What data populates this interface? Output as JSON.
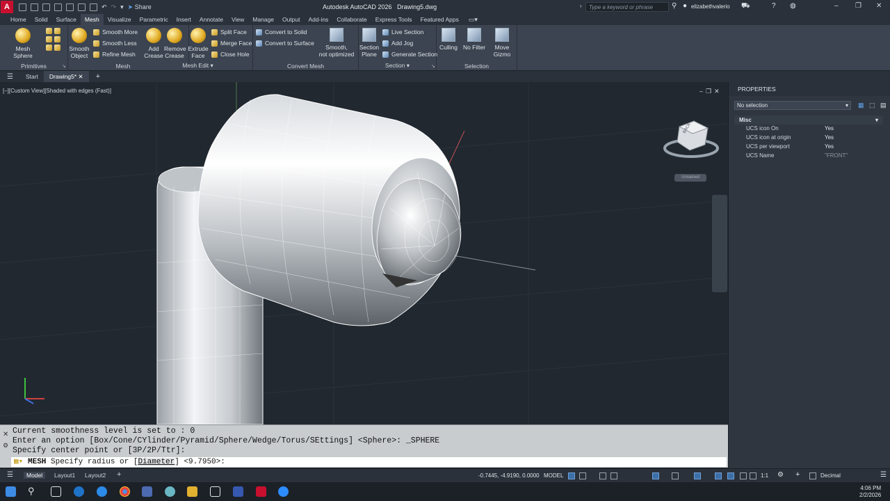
{
  "app": {
    "title": "Autodesk AutoCAD 2026",
    "file": "Drawing5.dwg",
    "logo": "A",
    "share": "Share",
    "search_placeholder": "Type a keyword or phrase",
    "user": "elizabethvalerio"
  },
  "ribbon_tabs": [
    "Home",
    "Solid",
    "Surface",
    "Mesh",
    "Visualize",
    "Parametric",
    "Insert",
    "Annotate",
    "View",
    "Manage",
    "Output",
    "Add-ins",
    "Collaborate",
    "Express Tools",
    "Featured Apps"
  ],
  "ribbon": {
    "primitives": {
      "title": "Primitives",
      "mesh_sphere": "Mesh Sphere"
    },
    "mesh": {
      "title": "Mesh",
      "smooth_object": [
        "Smooth",
        "Object"
      ],
      "smooth_more": "Smooth More",
      "smooth_less": "Smooth Less",
      "refine_mesh": "Refine Mesh"
    },
    "mesh_edit": {
      "title": "Mesh Edit",
      "add_crease": [
        "Add",
        "Crease"
      ],
      "remove_crease": [
        "Remove",
        "Crease"
      ],
      "extrude_face": [
        "Extrude",
        "Face"
      ],
      "split_face": "Split Face",
      "merge_face": "Merge Face",
      "close_hole": "Close Hole"
    },
    "convert_mesh": {
      "title": "Convert Mesh",
      "convert_to_solid": "Convert to Solid",
      "convert_to_surface": "Convert to Surface",
      "smooth_not_optimized": [
        "Smooth,",
        "not optimized"
      ]
    },
    "section": {
      "title": "Section",
      "section_plane": [
        "Section",
        "Plane"
      ],
      "live_section": "Live Section",
      "add_jog": "Add Jog",
      "generate_section": "Generate Section"
    },
    "selection": {
      "title": "Selection",
      "culling": "Culling",
      "no_filter": "No Filter",
      "move_gizmo": [
        "Move",
        "Gizmo"
      ]
    }
  },
  "doc_tabs": {
    "start": "Start",
    "active": "Drawing5*"
  },
  "viewport": {
    "label": "[–][Custom View][Shaded with edges (Fast)]",
    "viewcube_face": "BACK",
    "ucs_name_badge": "Unnamed"
  },
  "properties": {
    "title": "PROPERTIES",
    "selection": "No selection",
    "section": "Misc",
    "rows": [
      {
        "name": "UCS icon On",
        "value": "Yes"
      },
      {
        "name": "UCS icon at origin",
        "value": "Yes"
      },
      {
        "name": "UCS per viewport",
        "value": "Yes"
      },
      {
        "name": "UCS Name",
        "value": "\"FRONT\""
      }
    ]
  },
  "command": {
    "history": [
      "Current smoothness level is set to : 0",
      "Enter an option [Box/Cone/CYlinder/Pyramid/Sphere/Wedge/Torus/SEttings] <Sphere>: _SPHERE",
      "Specify center point or [3P/2P/Ttr]:"
    ],
    "cmd": "MESH",
    "prompt_pre": "Specify radius or [",
    "prompt_opt": "Diameter",
    "prompt_post": "] <9.7950>:"
  },
  "layout_tabs": [
    "Model",
    "Layout1",
    "Layout2"
  ],
  "status": {
    "coords": "-0.7445, -4.9190, 0.0000",
    "model": "MODEL",
    "scale": "1:1",
    "units": "Decimal"
  },
  "clock": {
    "time": "4:06 PM",
    "date": "2/2/2026"
  }
}
